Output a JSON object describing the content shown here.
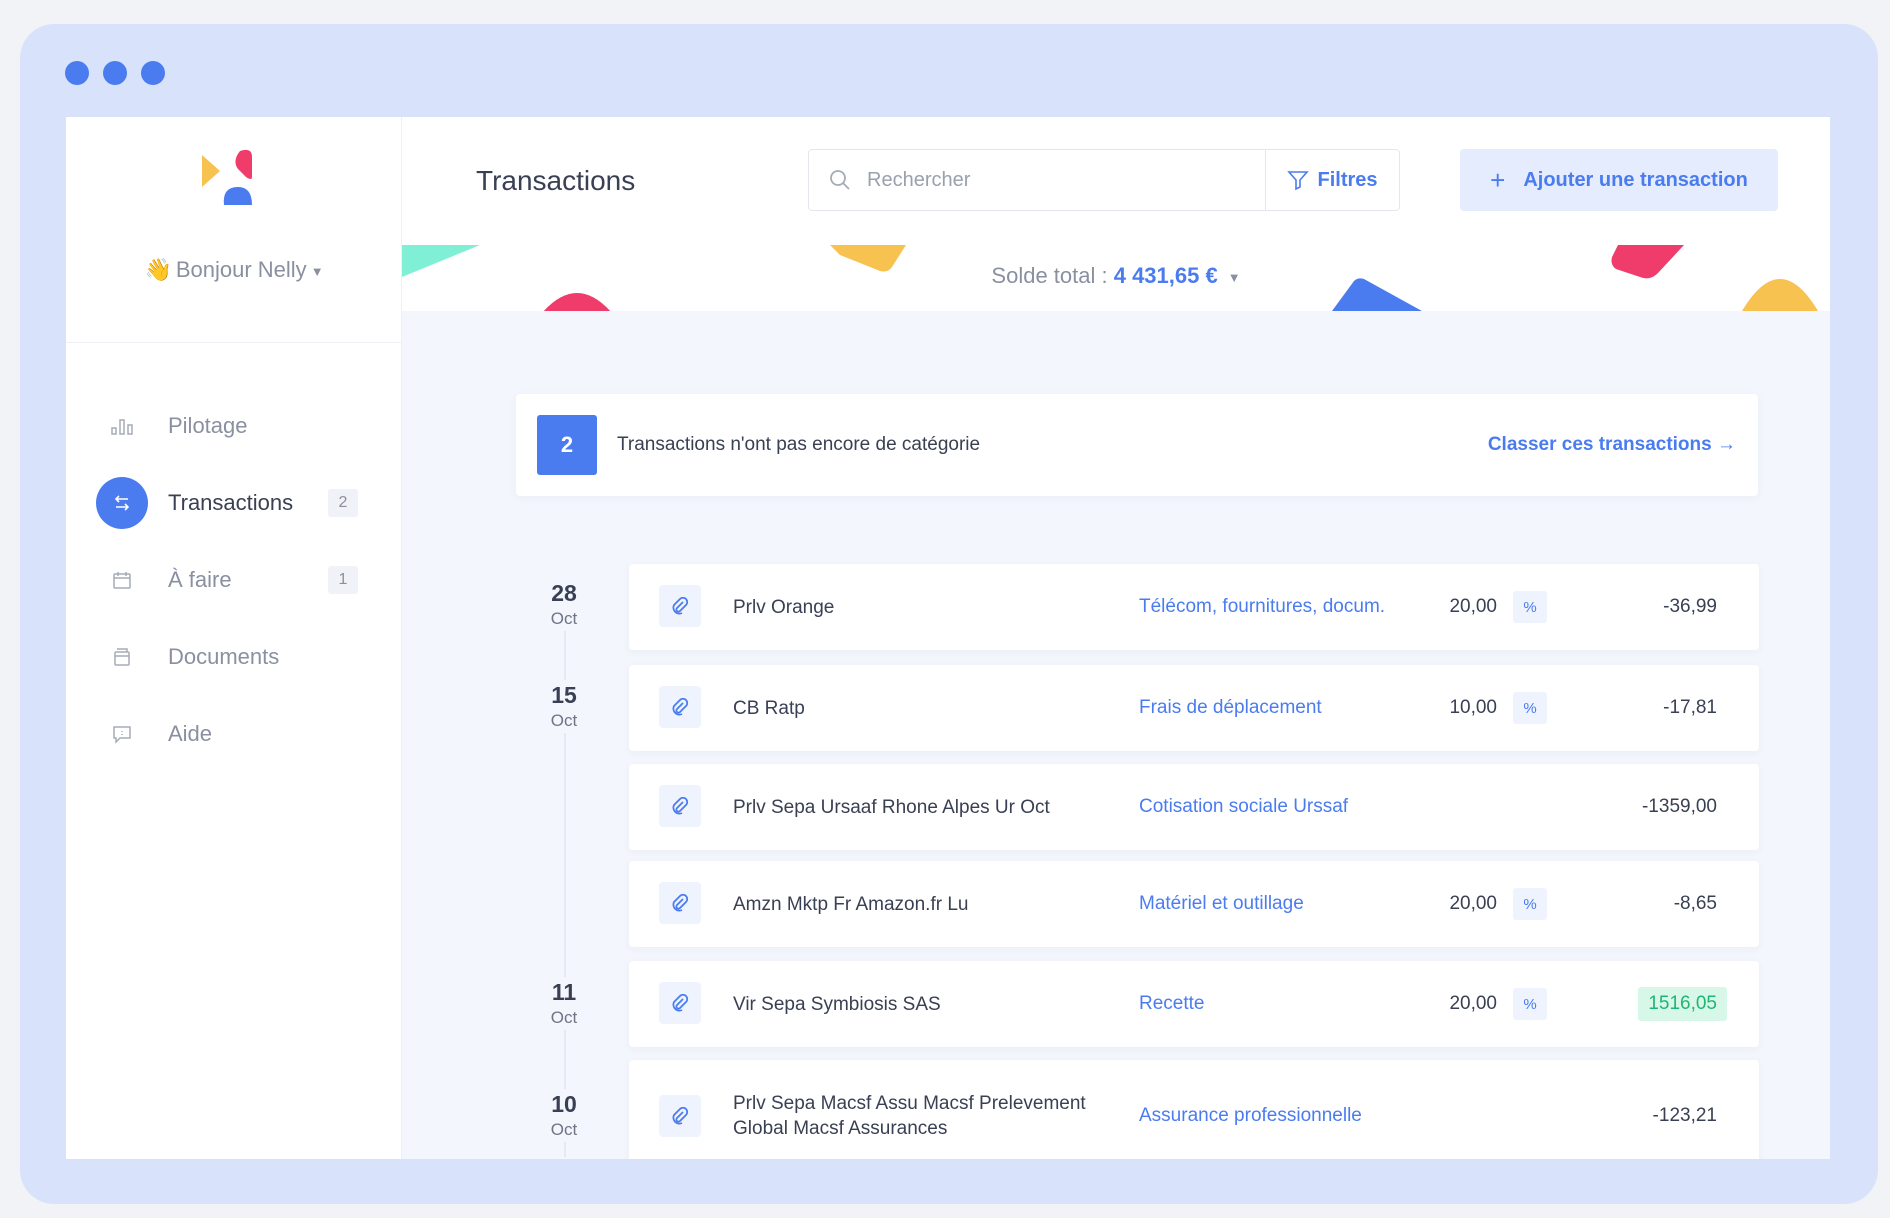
{
  "colors": {
    "accent": "#4a7cf0",
    "positive": "#21b573",
    "frame": "#d8e3fb"
  },
  "sidebar": {
    "greeting": "Bonjour Nelly",
    "greeting_emoji": "👋",
    "items": [
      {
        "label": "Pilotage",
        "icon": "bar-chart-icon",
        "badge": ""
      },
      {
        "label": "Transactions",
        "icon": "transfer-arrows-icon",
        "badge": "2",
        "active": true
      },
      {
        "label": "À faire",
        "icon": "calendar-icon",
        "badge": "1"
      },
      {
        "label": "Documents",
        "icon": "folder-icon",
        "badge": ""
      },
      {
        "label": "Aide",
        "icon": "help-chat-icon",
        "badge": ""
      }
    ]
  },
  "header": {
    "title": "Transactions",
    "search_placeholder": "Rechercher",
    "filters_label": "Filtres",
    "add_label": "Ajouter une transaction"
  },
  "balance": {
    "label": "Solde total :",
    "amount": "4 431,65 €"
  },
  "alert": {
    "count": "2",
    "text": "Transactions n'ont pas encore de catégorie",
    "link": "Classer ces transactions →"
  },
  "dates": [
    {
      "day": "28",
      "month": "Oct"
    },
    {
      "day": "15",
      "month": "Oct"
    },
    {
      "day": "11",
      "month": "Oct"
    },
    {
      "day": "10",
      "month": "Oct"
    }
  ],
  "transactions": [
    {
      "label": "Prlv Orange",
      "category": "Télécom, fournitures, docum.",
      "vat": "20,00",
      "pct": "%",
      "amount": "-36,99"
    },
    {
      "label": "CB Ratp",
      "category": "Frais de déplacement",
      "vat": "10,00",
      "pct": "%",
      "amount": "-17,81"
    },
    {
      "label": "Prlv Sepa Ursaaf Rhone Alpes Ur Oct",
      "category": "Cotisation sociale Urssaf",
      "vat": "",
      "pct": "",
      "amount": "-1359,00"
    },
    {
      "label": "Amzn Mktp Fr Amazon.fr Lu",
      "category": "Matériel et outillage",
      "vat": "20,00",
      "pct": "%",
      "amount": "-8,65"
    },
    {
      "label": "Vir Sepa Symbiosis SAS",
      "category": "Recette",
      "vat": "20,00",
      "pct": "%",
      "amount": "1516,05"
    },
    {
      "label": "Prlv Sepa Macsf Assu Macsf Prelevement Global Macsf Assurances",
      "category": "Assurance professionnelle",
      "vat": "",
      "pct": "",
      "amount": "-123,21"
    }
  ]
}
